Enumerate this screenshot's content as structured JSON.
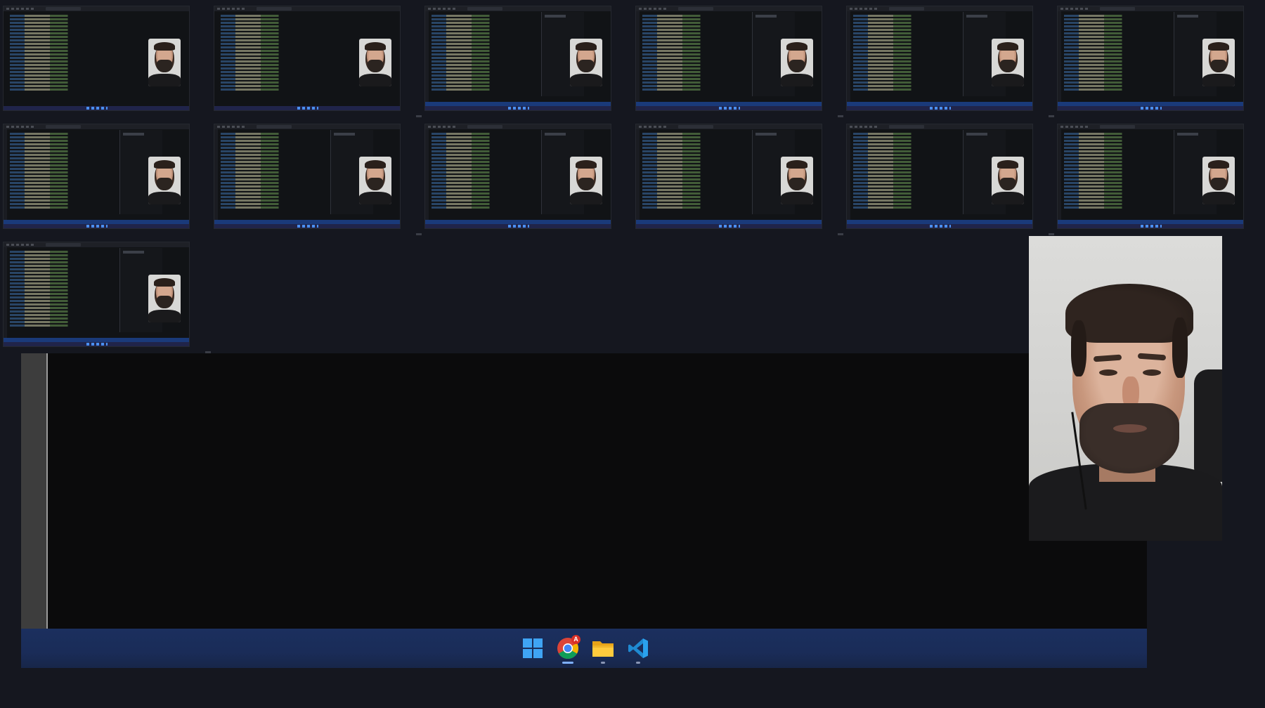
{
  "thumbnails": [
    {
      "kind": "browser"
    },
    {
      "kind": "browser"
    },
    {
      "kind": "vscode"
    },
    {
      "kind": "vscode"
    },
    {
      "kind": "vscode"
    },
    {
      "kind": "vscode"
    },
    {
      "kind": "vscode"
    },
    {
      "kind": "vscode"
    },
    {
      "kind": "vscode"
    },
    {
      "kind": "vscode"
    },
    {
      "kind": "vscode"
    },
    {
      "kind": "vscode"
    },
    {
      "kind": "vscode"
    }
  ],
  "taskbar": {
    "items": [
      {
        "name": "windows-start-icon",
        "state": "normal"
      },
      {
        "name": "chrome-icon",
        "state": "active",
        "badge": "A"
      },
      {
        "name": "file-explorer-icon",
        "state": "running"
      },
      {
        "name": "vscode-icon",
        "state": "running"
      }
    ]
  },
  "colors": {
    "background": "#15171f",
    "taskbar": "#1b2f5e",
    "editor": "#0b0b0c",
    "gutter": "#3d3d3d"
  }
}
